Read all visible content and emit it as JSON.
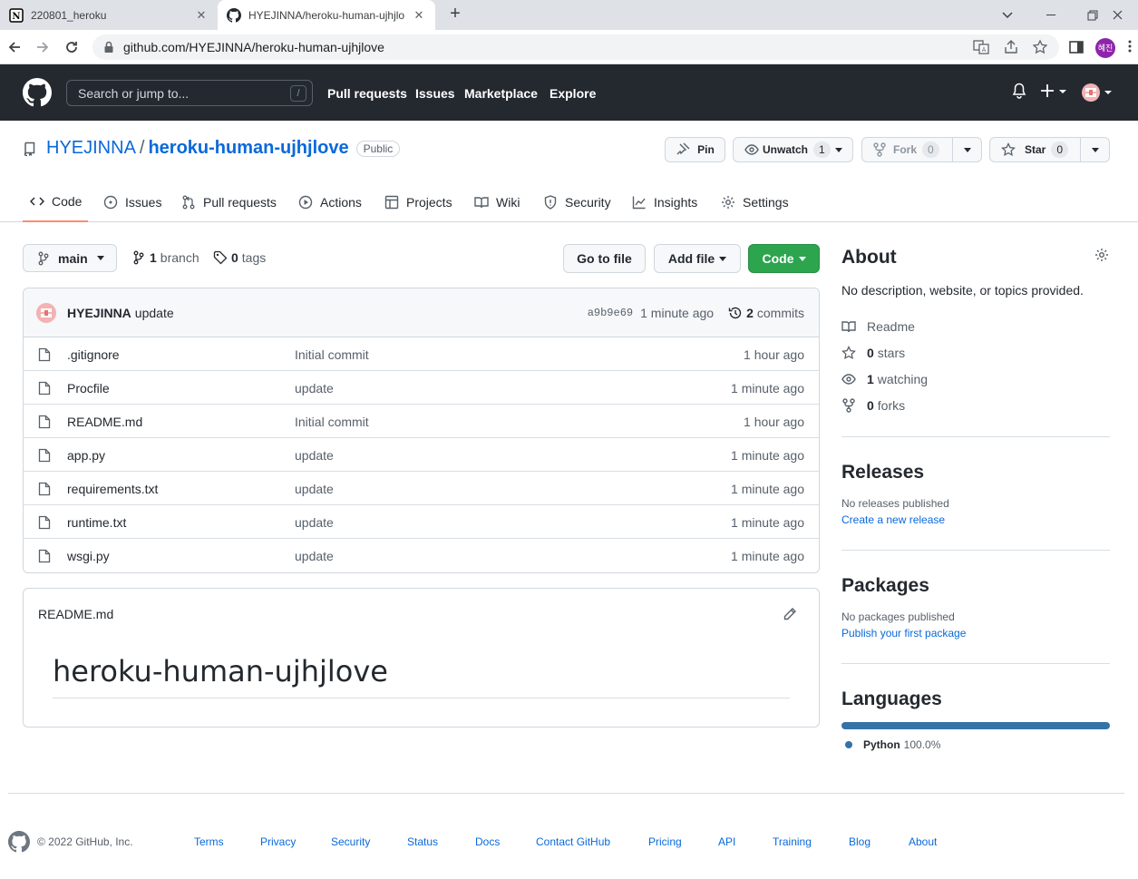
{
  "browser": {
    "tabs": [
      {
        "title": "220801_heroku"
      },
      {
        "title": "HYEJINNA/heroku-human-ujhjlo"
      }
    ],
    "url": "github.com/HYEJINNA/heroku-human-ujhjlove",
    "profile_initials": "혜진"
  },
  "header": {
    "search_placeholder": "Search or jump to...",
    "search_shortcut": "/",
    "nav": [
      "Pull requests",
      "Issues",
      "Marketplace",
      "Explore"
    ]
  },
  "repo": {
    "owner": "HYEJINNA",
    "name": "heroku-human-ujhjlove",
    "visibility": "Public",
    "buttons": {
      "pin": "Pin",
      "unwatch": "Unwatch",
      "watch_count": "1",
      "fork": "Fork",
      "fork_count": "0",
      "star": "Star",
      "star_count": "0"
    },
    "tabs": [
      "Code",
      "Issues",
      "Pull requests",
      "Actions",
      "Projects",
      "Wiki",
      "Security",
      "Insights",
      "Settings"
    ]
  },
  "toolbar": {
    "branch": "main",
    "branch_count": "1",
    "branch_label": "branch",
    "tag_count": "0",
    "tag_label": "tags",
    "go_to_file": "Go to file",
    "add_file": "Add file",
    "code": "Code"
  },
  "commit": {
    "author": "HYEJINNA",
    "message": "update",
    "sha": "a9b9e69",
    "time": "1 minute ago",
    "count": "2",
    "count_label": "commits"
  },
  "files": [
    {
      "name": ".gitignore",
      "message": "Initial commit",
      "age": "1 hour ago"
    },
    {
      "name": "Procfile",
      "message": "update",
      "age": "1 minute ago"
    },
    {
      "name": "README.md",
      "message": "Initial commit",
      "age": "1 hour ago"
    },
    {
      "name": "app.py",
      "message": "update",
      "age": "1 minute ago"
    },
    {
      "name": "requirements.txt",
      "message": "update",
      "age": "1 minute ago"
    },
    {
      "name": "runtime.txt",
      "message": "update",
      "age": "1 minute ago"
    },
    {
      "name": "wsgi.py",
      "message": "update",
      "age": "1 minute ago"
    }
  ],
  "readme": {
    "filename": "README.md",
    "heading": "heroku-human-ujhjlove"
  },
  "about": {
    "title": "About",
    "description": "No description, website, or topics provided.",
    "readme": "Readme",
    "stars_count": "0",
    "stars_label": "stars",
    "watching_count": "1",
    "watching_label": "watching",
    "forks_count": "0",
    "forks_label": "forks"
  },
  "releases": {
    "title": "Releases",
    "empty": "No releases published",
    "link": "Create a new release"
  },
  "packages": {
    "title": "Packages",
    "empty": "No packages published",
    "link": "Publish your first package"
  },
  "languages": {
    "title": "Languages",
    "items": [
      {
        "name": "Python",
        "percent": "100.0%",
        "color": "#3572a5"
      }
    ]
  },
  "footer": {
    "copyright": "© 2022 GitHub, Inc.",
    "links": [
      "Terms",
      "Privacy",
      "Security",
      "Status",
      "Docs",
      "Contact GitHub",
      "Pricing",
      "API",
      "Training",
      "Blog",
      "About"
    ]
  },
  "colors": {
    "header_bg": "#24292f",
    "link": "#0969da",
    "primary_button": "#2da44e",
    "tab_underline": "#fd8c73"
  }
}
